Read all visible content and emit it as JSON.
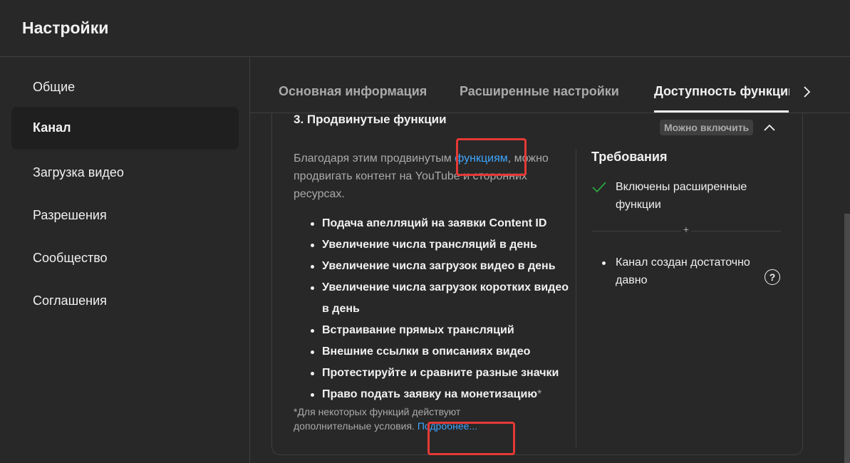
{
  "dialog": {
    "title": "Настройки"
  },
  "sidebar": {
    "items": [
      {
        "label": "Общие"
      },
      {
        "label": "Канал",
        "active": true
      },
      {
        "label": "Загрузка видео"
      },
      {
        "label": "Разрешения"
      },
      {
        "label": "Сообщество"
      },
      {
        "label": "Соглашения"
      }
    ]
  },
  "tabs": {
    "items": [
      {
        "label": "Основная информация"
      },
      {
        "label": "Расширенные настройки"
      },
      {
        "label": "Доступность функций",
        "active": true
      }
    ],
    "next_icon": "chevron-right-icon"
  },
  "section": {
    "title": "3. Продвинутые функции",
    "status": "Можно включить",
    "collapse_icon": "chevron-up-icon",
    "description_before": "Благодаря этим продвинутым ",
    "description_link": "функциям",
    "description_after": ", можно продвигать контент на YouTube и сторонних ресурсах.",
    "features": [
      "Подача апелляций на заявки Content ID",
      "Увеличение числа трансляций в день",
      "Увеличение числа загрузок видео в день",
      "Увеличение числа загрузок коротких видео в день",
      "Встраивание прямых трансляций",
      "Внешние ссылки в описаниях видео",
      "Протестируйте и сравните разные значки",
      "Право подать заявку на монетизацию"
    ],
    "feature_star": "*",
    "footnote_text": "*Для некоторых функций действуют дополнительные условия. ",
    "footnote_link": "Подробнее..."
  },
  "requirements": {
    "title": "Требования",
    "met": "Включены расширенные функции",
    "separator": "+",
    "pending": "Канал создан достаточно давно",
    "help_symbol": "?"
  },
  "colors": {
    "background": "#282828",
    "link": "#3ea6ff",
    "check": "#2ba640",
    "highlight": "#e53935"
  }
}
